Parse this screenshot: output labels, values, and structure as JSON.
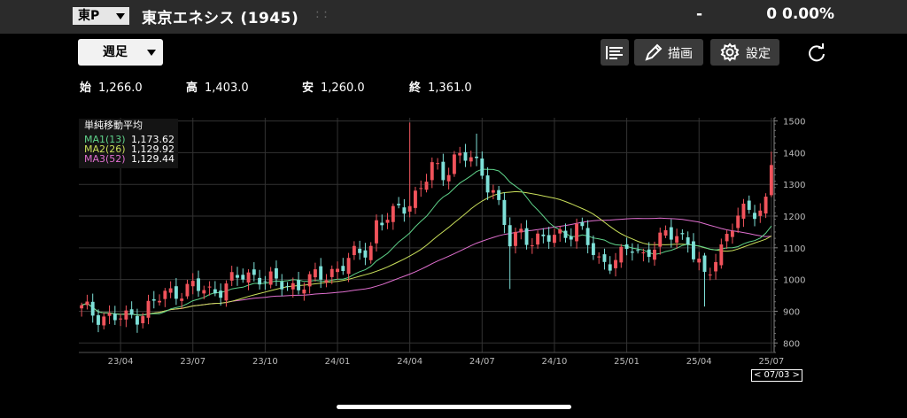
{
  "header": {
    "market": "東P",
    "title": "東京エネシス (1945)",
    "dots": ": :",
    "price": "-",
    "change": "0  0.00%"
  },
  "toolbar": {
    "period": "週足",
    "draw_label": "描画",
    "settings_label": "設定"
  },
  "ohlc": [
    {
      "key": "始",
      "value": "1,266.0"
    },
    {
      "key": "高",
      "value": "1,403.0"
    },
    {
      "key": "安",
      "value": "1,260.0"
    },
    {
      "key": "終",
      "value": "1,361.0"
    }
  ],
  "legend": {
    "header": "単純移動平均",
    "items": [
      {
        "name": "MA1(13)",
        "value": "1,173.62",
        "color": "#5fd38a"
      },
      {
        "name": "MA2(26)",
        "value": "1,129.92",
        "color": "#c9df5a"
      },
      {
        "name": "MA3(52)",
        "value": "1,129.44",
        "color": "#e06fcf"
      }
    ]
  },
  "date_badge": "< 07/03 >",
  "colors": {
    "up": "#f0535b",
    "down": "#7ee0d8",
    "grid": "#333333",
    "axis_text": "#bbbbbb"
  },
  "chart_data": {
    "type": "candlestick",
    "title": "",
    "x_tick_labels": [
      "23/04",
      "23/07",
      "23/10",
      "24/01",
      "24/04",
      "24/07",
      "24/10",
      "25/01",
      "25/04",
      "25/07"
    ],
    "x_tick_weeks": [
      7,
      20,
      33,
      46,
      59,
      72,
      85,
      98,
      111,
      124
    ],
    "weeks": 125,
    "ylim": [
      770,
      1510
    ],
    "y_ticks": [
      800,
      900,
      1000,
      1100,
      1200,
      1300,
      1400,
      1500
    ],
    "anchors": [
      [
        0,
        905
      ],
      [
        5,
        880
      ],
      [
        8,
        875
      ],
      [
        11,
        900
      ],
      [
        14,
        940
      ],
      [
        17,
        965
      ],
      [
        20,
        975
      ],
      [
        23,
        960
      ],
      [
        26,
        985
      ],
      [
        29,
        1010
      ],
      [
        32,
        1015
      ],
      [
        35,
        985
      ],
      [
        38,
        980
      ],
      [
        41,
        995
      ],
      [
        44,
        1015
      ],
      [
        47,
        1050
      ],
      [
        50,
        1080
      ],
      [
        52,
        1110
      ],
      [
        53,
        1180
      ],
      [
        56,
        1200
      ],
      [
        59,
        1250
      ],
      [
        61,
        1290
      ],
      [
        63,
        1350
      ],
      [
        65,
        1330
      ],
      [
        67,
        1390
      ],
      [
        70,
        1380
      ],
      [
        72,
        1330
      ],
      [
        74,
        1290
      ],
      [
        75,
        1230
      ],
      [
        76,
        1170
      ],
      [
        77,
        1110
      ],
      [
        79,
        1150
      ],
      [
        81,
        1130
      ],
      [
        83,
        1120
      ],
      [
        85,
        1135
      ],
      [
        87,
        1150
      ],
      [
        89,
        1165
      ],
      [
        90,
        1140
      ],
      [
        91,
        1110
      ],
      [
        93,
        1060
      ],
      [
        95,
        1060
      ],
      [
        97,
        1070
      ],
      [
        99,
        1100
      ],
      [
        101,
        1080
      ],
      [
        103,
        1110
      ],
      [
        105,
        1130
      ],
      [
        107,
        1150
      ],
      [
        109,
        1120
      ],
      [
        111,
        1050
      ],
      [
        112,
        990
      ],
      [
        113,
        1020
      ],
      [
        114,
        1080
      ],
      [
        116,
        1140
      ],
      [
        118,
        1200
      ],
      [
        120,
        1210
      ],
      [
        122,
        1230
      ],
      [
        123,
        1250
      ],
      [
        124,
        1361
      ]
    ],
    "spikes": [
      [
        59,
        1495
      ],
      [
        71,
        1460
      ],
      [
        77,
        970
      ],
      [
        112,
        915
      ]
    ],
    "last_candle": {
      "open": 1266.0,
      "high": 1403.0,
      "low": 1260.0,
      "close": 1361.0
    },
    "series": [
      {
        "name": "MA1(13)",
        "last": 1173.62
      },
      {
        "name": "MA2(26)",
        "last": 1129.92
      },
      {
        "name": "MA3(52)",
        "last": 1129.44
      }
    ]
  }
}
